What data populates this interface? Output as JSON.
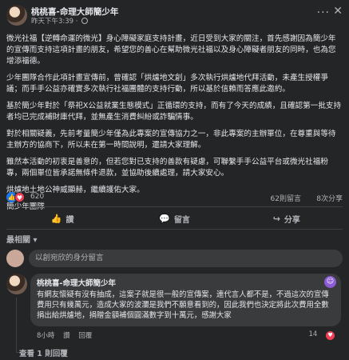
{
  "post": {
    "author": "桃桃喜-命理大師簡少年",
    "time": "昨天下午3:39",
    "more": "···",
    "close": "✕",
    "paragraphs": [
      "微光社福【逆轉命運的微光】身心障礙家庭支持計畫，近日受到大家的關注，首先感謝因為簡少年的宣傳而支持這項計畫的朋友，希望您的善心在幫助微光社福以及身心障礙者朋友的同時，也為您增添福德。",
      "少年團隊合作此項計畫宣傳前，曾確認「烘爐地文創」多次執行烘爐地代拜活動，未產生授權爭議；而手手公益亦確實多次執行社福團體的支持行動，所以基於信賴而答應此邀約。",
      "基於簡少年對於「祭祀X公益就業生態模式」正循環的支持，而有了今天的成績，且確認第一批支持者均已完成補財庫代拜，並無產生消費糾紛或詐騙情事。",
      "對於相關疑義，先前考量簡少年僅為此專案的宣傳協力之一，非此專案的主辦單位，在尊重與等待主辦方的協商下，所以未在第一時間說明，還請大家理解。",
      "雖然本活動的初衷是善意的，但若您對已支持的善款有疑慮，可聯繫手手公益平台或微光社福粉專，兩個單位皆承諾無條件退款，並協助後續處理，請大家安心。",
      "烘爐地土地公神威顯赫，繼續護佑大家。",
      "簡少年團隊"
    ]
  },
  "stats": {
    "reaction_count": "620",
    "comment_count": "62則留言",
    "share_count": "8次分享"
  },
  "actions": {
    "like": "讚",
    "comment": "留言",
    "share": "分享"
  },
  "sort_label": "最相關 ▾",
  "composer": {
    "placeholder": "以創宛欣的身分留言"
  },
  "comment": {
    "author": "桃桃喜-命理大師簡少年",
    "text": "有網友懷疑有沒有抽成，這案子就是很一般的宣傳案，連代言人都不是，不過這次的宣傳費用只有幾萬元，造成大家的波瀾是我們不願意看到的，因此我們也決定將此次費用全數捐出給烘爐地，捐贈金額補個圓滿數字到十萬元，感謝大家",
    "time": "8小時",
    "like": "讚",
    "reply": "回覆",
    "like_count": "14",
    "view_replies": "查看 1 則回覆"
  },
  "colors": {
    "background": "#242526",
    "bubble": "#3a3b3c",
    "text": "#e4e6eb",
    "muted": "#b0b3b8",
    "like_blue": "#1877f2",
    "love_red": "#f33e58"
  },
  "icons": {
    "like": "like-icon",
    "love": "love-icon",
    "comment": "comment-icon",
    "share": "share-icon",
    "globe": "globe-icon",
    "emoji": "emoji-icon"
  }
}
